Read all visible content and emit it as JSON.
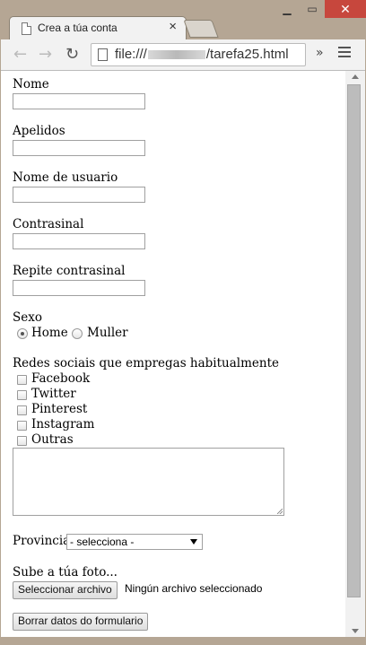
{
  "browser": {
    "tab_title": "Crea a túa conta",
    "url_prefix": "file:///",
    "url_suffix": "/tarefa25.html"
  },
  "form": {
    "nome_label": "Nome",
    "apelidos_label": "Apelidos",
    "usuario_label": "Nome de usuario",
    "contrasinal_label": "Contrasinal",
    "repite_label": "Repite contrasinal",
    "sexo_label": "Sexo",
    "sexo_options": [
      "Home",
      "Muller"
    ],
    "sexo_selected": "Home",
    "redes_label": "Redes sociais que empregas habitualmente",
    "redes_options": [
      "Facebook",
      "Twitter",
      "Pinterest",
      "Instagram",
      "Outras"
    ],
    "provincia_label": "Provincia",
    "provincia_value": "- selecciona -",
    "foto_label": "Sube a túa foto...",
    "file_button": "Seleccionar archivo",
    "file_status": "Ningún archivo seleccionado",
    "reset_button": "Borrar datos do formulario"
  }
}
